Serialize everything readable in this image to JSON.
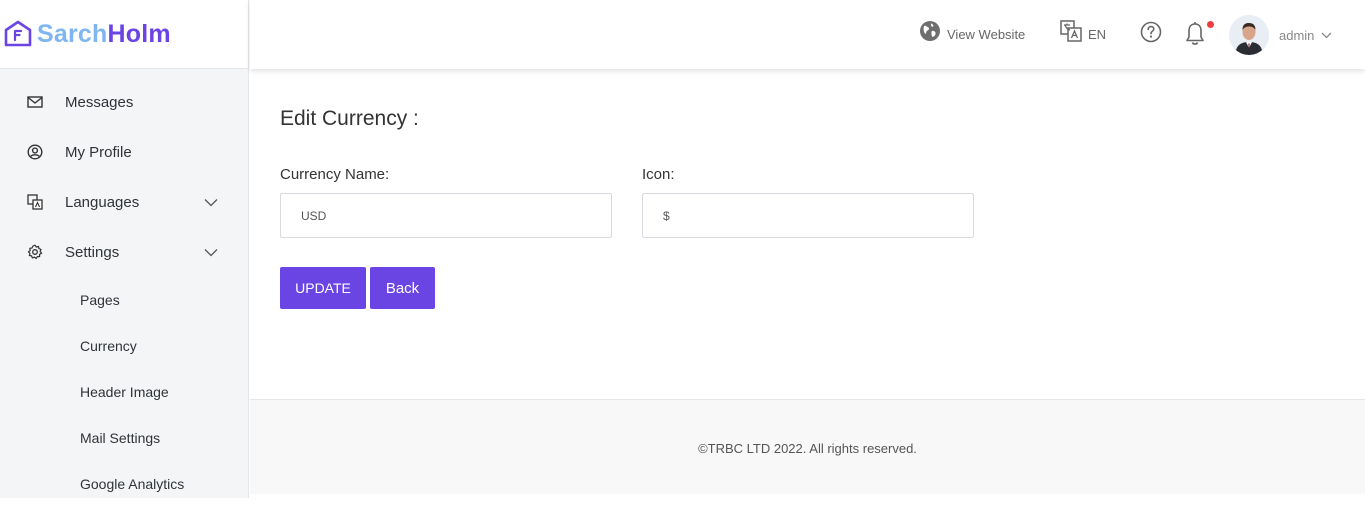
{
  "brand": {
    "name_part1": "Sarch",
    "name_part2": "Holm",
    "color_part1": "#7fb6f2",
    "color_part2": "#6b44e6"
  },
  "sidebar": {
    "items": [
      {
        "label": "Messages",
        "icon": "envelope-icon"
      },
      {
        "label": "My Profile",
        "icon": "user-circle-icon"
      },
      {
        "label": "Languages",
        "icon": "translate-icon",
        "expandable": true
      },
      {
        "label": "Settings",
        "icon": "gear-icon",
        "expandable": true,
        "expanded": true
      }
    ],
    "settings_subitems": [
      "Pages",
      "Currency",
      "Header Image",
      "Mail Settings",
      "Google Analytics"
    ]
  },
  "header": {
    "view_website": "View Website",
    "language": "EN",
    "user_name": "admin",
    "notification_dot_color": "#ef3c3c"
  },
  "main": {
    "title": "Edit Currency :",
    "fields": {
      "currency_name": {
        "label": "Currency Name:",
        "value": "USD"
      },
      "icon": {
        "label": "Icon:",
        "value": "$"
      }
    },
    "buttons": {
      "update": "UPDATE",
      "back": "Back"
    },
    "accent_color": "#6a45e3"
  },
  "footer": {
    "text": "©TRBC LTD 2022. All rights reserved."
  }
}
